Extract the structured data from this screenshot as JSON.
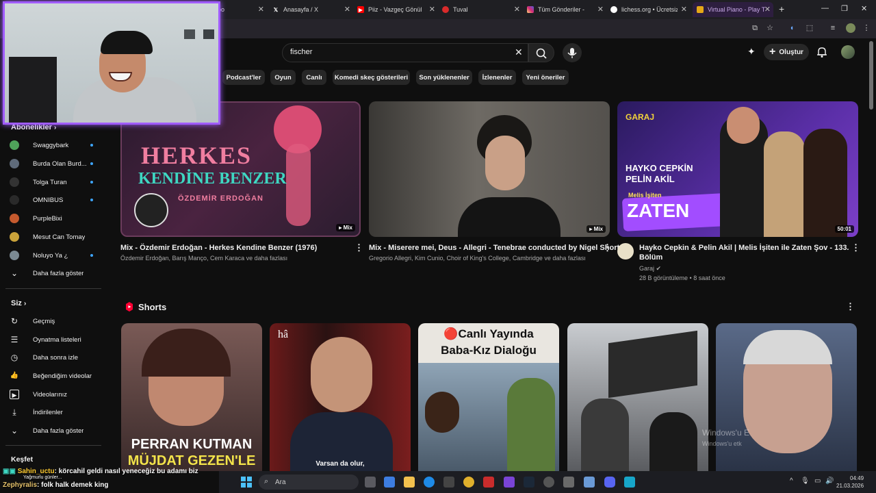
{
  "browser": {
    "tabs": [
      {
        "title": "bo",
        "icon": "unknown-icon",
        "color": "#888888"
      },
      {
        "title": "Anasayfa / X",
        "icon": "x-icon",
        "color": "#000000"
      },
      {
        "title": "Piiz - Vazgeç Gönül (",
        "icon": "youtube-icon",
        "color": "#ff0000"
      },
      {
        "title": "Tuval",
        "icon": "tuval-icon",
        "color": "#d92b2b"
      },
      {
        "title": "Tüm Gönderiler -",
        "icon": "instagram-icon",
        "color": "#d62976"
      },
      {
        "title": "lichess.org • Ücretsiz",
        "icon": "lichess-icon",
        "color": "#ffffff"
      },
      {
        "title": "Virtual Piano - Play T",
        "icon": "piano-icon",
        "color": "#e6a817",
        "active": true
      }
    ],
    "new_tab": "+",
    "close_glyph": "✕"
  },
  "youtube": {
    "search": {
      "value": "fischer"
    },
    "create_label": "Oluştur",
    "chips": [
      "Podcast'ler",
      "Oyun",
      "Canlı",
      "Komedi skeç gösterileri",
      "Son yüklenenler",
      "İzlenenler",
      "Yeni öneriler"
    ],
    "sidebar": {
      "subscriptions_heading": "Abonelikler",
      "subscriptions": [
        {
          "name": "Swaggybark",
          "color": "#4fa35a"
        },
        {
          "name": "Burda Olan Burd...",
          "color": "#5f6b7a"
        },
        {
          "name": "Tolga Turan",
          "color": "#333333"
        },
        {
          "name": "OMNIBUS",
          "color": "#2a2a2a"
        },
        {
          "name": "PurpleBixi",
          "color": "#c55a2e"
        },
        {
          "name": "Mesut Can Tomay",
          "color": "#c9a23a"
        },
        {
          "name": "Noluyo Ya ¿",
          "color": "#7b8a93"
        }
      ],
      "show_more_1": "Daha fazla göster",
      "you_heading": "Siz",
      "you_items": [
        {
          "label": "Geçmiş",
          "icon": "history-icon",
          "glyph": "↻"
        },
        {
          "label": "Oynatma listeleri",
          "icon": "playlists-icon",
          "glyph": "☰"
        },
        {
          "label": "Daha sonra izle",
          "icon": "watch-later-icon",
          "glyph": "◷"
        },
        {
          "label": "Beğendiğim videolar",
          "icon": "like-icon",
          "glyph": "👍"
        },
        {
          "label": "Videolarınız",
          "icon": "your-videos-icon",
          "glyph": "▶"
        },
        {
          "label": "İndirilenler",
          "icon": "download-icon",
          "glyph": "⤓"
        }
      ],
      "show_more_2": "Daha fazla göster",
      "explore_heading": "Keşfet"
    },
    "videos": [
      {
        "title": "Mix - Özdemir Erdoğan - Herkes Kendine Benzer (1976)",
        "meta": "Özdemir Erdoğan, Barış Manço, Cem Karaca ve daha fazlası",
        "badge": "Mix",
        "thumb_text_1": "HERKES",
        "thumb_text_2": "KENDİNE BENZER",
        "thumb_text_3": "ÖZDEMİR ERDOĞAN"
      },
      {
        "title": "Mix - Miserere mei, Deus - Allegri - Tenebrae conducted by Nigel Short",
        "meta": "Gregorio Allegri, Kim Cunio, Choir of King's College, Cambridge ve daha fazlası",
        "badge": "Mix"
      },
      {
        "title_line1": "Hayko Cepkin & Pelin Akil | Melis İşiten ile Zaten Şov - 133.",
        "title_line2": "Bölüm",
        "channel": "Garaj",
        "stats": "28 B görüntüleme • 8 saat önce",
        "badge": "50:01",
        "thumb_text_1": "GARAJ",
        "thumb_text_2": "HAYKO CEPKİN",
        "thumb_text_3": "PELİN AKİL",
        "thumb_text_4": "ZATEN",
        "thumb_text_5": "Melis İşiten"
      }
    ],
    "shorts_heading": "Shorts",
    "shorts": [
      {
        "caption_1": "PERRAN KUTMAN",
        "caption_2": "MÜJDAT GEZEN'LE"
      },
      {
        "caption": "Varsan da olur,",
        "tag": "hâ"
      },
      {
        "caption_1": "🔴Canlı Yayında",
        "caption_2": "Baba-Kız Dialoğu"
      },
      {},
      {}
    ]
  },
  "chat": [
    {
      "nick": "Sahin_uctu",
      "text": ": körcahil geldi nasıl yeneceğiz bu adamı biz"
    },
    {
      "sub": "Yağmurlu günler..."
    },
    {
      "nick": "Zephyralis",
      "text": ": folk halk demek king"
    }
  ],
  "watermark": {
    "line1": "Windows'u E",
    "line2": "Windows'u etk"
  },
  "taskbar": {
    "search": "Ara",
    "time": "04:49",
    "date": "21.03.2026"
  }
}
